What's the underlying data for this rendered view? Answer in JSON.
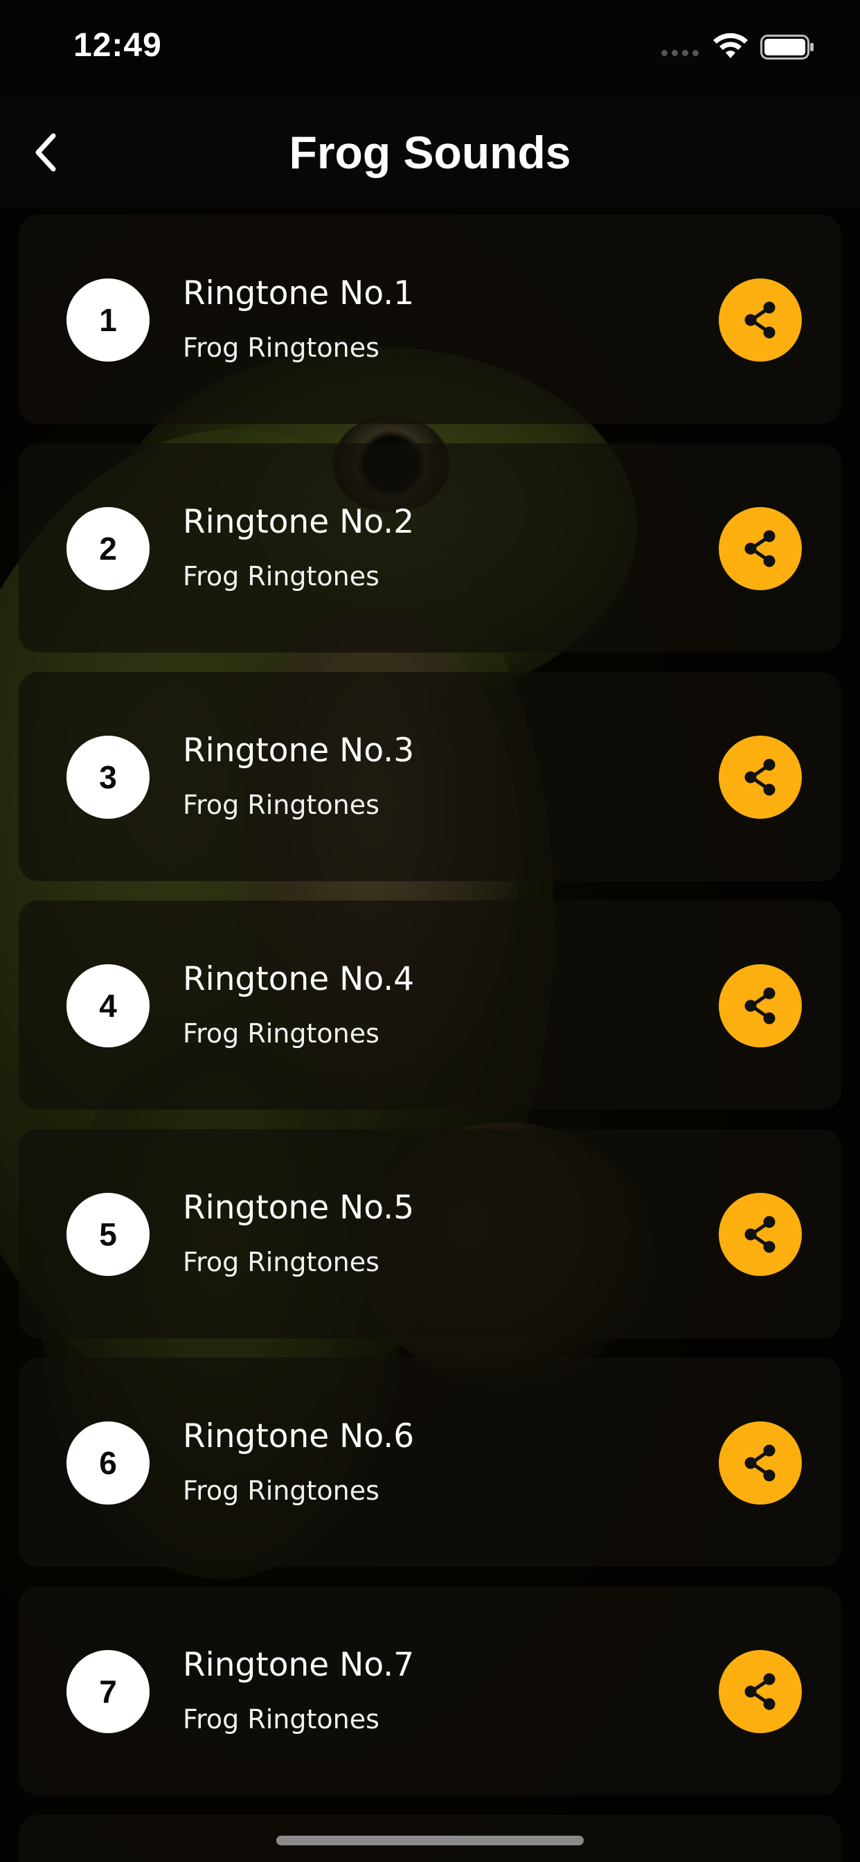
{
  "status_bar": {
    "time": "12:49"
  },
  "nav": {
    "title": "Frog Sounds",
    "back_icon": "chevron-left-icon"
  },
  "colors": {
    "accent": "#fcaf0f",
    "card_background": "rgba(18,15,10,0.72)",
    "number_circle": "#ffffff"
  },
  "ringtones": [
    {
      "number": "1",
      "title": "Ringtone No.1",
      "subtitle": "Frog Ringtones",
      "action_icon": "share-icon"
    },
    {
      "number": "2",
      "title": "Ringtone No.2",
      "subtitle": "Frog Ringtones",
      "action_icon": "share-icon"
    },
    {
      "number": "3",
      "title": "Ringtone No.3",
      "subtitle": "Frog Ringtones",
      "action_icon": "share-icon"
    },
    {
      "number": "4",
      "title": "Ringtone No.4",
      "subtitle": "Frog Ringtones",
      "action_icon": "share-icon"
    },
    {
      "number": "5",
      "title": "Ringtone No.5",
      "subtitle": "Frog Ringtones",
      "action_icon": "share-icon"
    },
    {
      "number": "6",
      "title": "Ringtone No.6",
      "subtitle": "Frog Ringtones",
      "action_icon": "share-icon"
    },
    {
      "number": "7",
      "title": "Ringtone No.7",
      "subtitle": "Frog Ringtones",
      "action_icon": "share-icon"
    }
  ]
}
